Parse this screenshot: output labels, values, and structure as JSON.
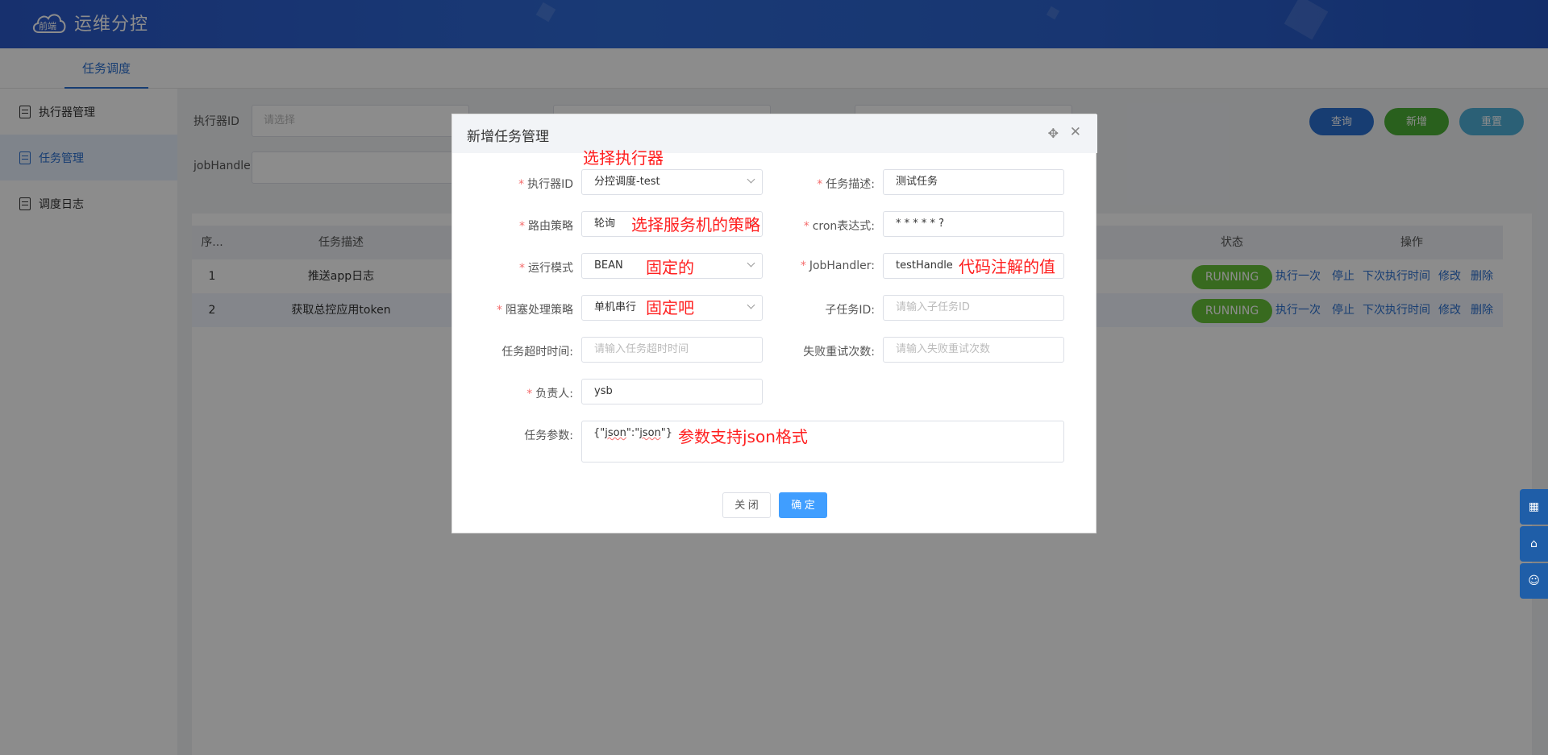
{
  "app": {
    "title": "运维分控",
    "logo_text": "前端"
  },
  "top_tabs": [
    {
      "label": "任务调度"
    }
  ],
  "sidebar": {
    "items": [
      {
        "label": "执行器管理"
      },
      {
        "label": "任务管理"
      },
      {
        "label": "调度日志"
      }
    ]
  },
  "filter": {
    "executor_label": "执行器ID",
    "executor_placeholder": "请选择",
    "jobhandler_label": "jobHandler",
    "query_button": "查询",
    "add_button": "新增",
    "reset_button": "重置"
  },
  "table": {
    "headers": {
      "index": "序...",
      "desc": "任务描述",
      "status": "状态",
      "ops": "操作"
    },
    "rows": [
      {
        "index": "1",
        "desc": "推送app日志",
        "status": "RUNNING"
      },
      {
        "index": "2",
        "desc": "获取总控应用token",
        "status": "RUNNING"
      }
    ],
    "ops": {
      "run_once": "执行一次",
      "stop": "停止",
      "next_time": "下次执行时间",
      "edit": "修改",
      "delete": "删除"
    }
  },
  "dialog": {
    "title": "新增任务管理",
    "fields": {
      "executor": {
        "label": "执行器ID",
        "value": "分控调度-test"
      },
      "desc": {
        "label": "任务描述:",
        "value": "测试任务"
      },
      "route": {
        "label": "路由策略",
        "value": "轮询"
      },
      "cron": {
        "label": "cron表达式:",
        "value": "* * * * * ?"
      },
      "mode": {
        "label": "运行模式",
        "value": "BEAN"
      },
      "jobhandler": {
        "label": "JobHandler:",
        "value": "testHandle"
      },
      "block": {
        "label": "阻塞处理策略",
        "value": "单机串行"
      },
      "child": {
        "label": "子任务ID:",
        "placeholder": "请输入子任务ID"
      },
      "timeout": {
        "label": "任务超时时间:",
        "placeholder": "请输入任务超时时间"
      },
      "retry": {
        "label": "失败重试次数:",
        "placeholder": "请输入失败重试次数"
      },
      "owner": {
        "label": "负责人:",
        "value": "ysb"
      },
      "params": {
        "label": "任务参数:",
        "prefix": "{\"",
        "k": "json",
        "mid": "\":\"",
        "v": "json",
        "suffix": "\"}"
      }
    },
    "close_button": "关 闭",
    "confirm_button": "确 定"
  },
  "annotations": {
    "executor": "选择执行器",
    "route": "选择服务机的策略",
    "mode": "固定的",
    "jobhandler": "代码注解的值",
    "block": "固定吧",
    "params": "参数支持json格式"
  },
  "colors": {
    "primary": "#2a6fd0",
    "running": "#67c23a",
    "required": "#f56c6c",
    "annotation": "#ff1f1f",
    "confirm": "#409eff"
  }
}
